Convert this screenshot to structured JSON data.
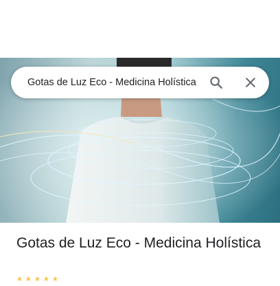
{
  "search": {
    "query": "Gotas de Luz Eco - Medicina Holística"
  },
  "place": {
    "title": "Gotas de Luz Eco - Medicina Holística"
  },
  "icons": {
    "search": "search-icon",
    "close": "close-icon",
    "star": "star-icon"
  },
  "colors": {
    "title_text": "#202124",
    "icon": "#5f6368",
    "star": "#f6c343"
  }
}
